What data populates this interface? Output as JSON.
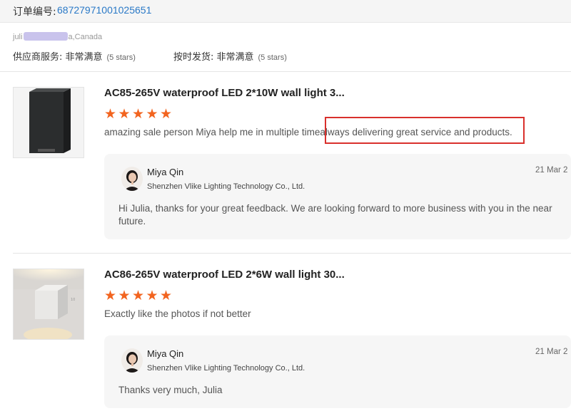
{
  "order": {
    "label": "订单编号:",
    "number": "68727971001025651"
  },
  "buyer": {
    "name_prefix": "juli",
    "location": "a,Canada"
  },
  "ratings": {
    "supplier_service_label": "供应商服务: 非常满意",
    "supplier_service_stars": "(5 stars)",
    "on_time_label": "按时发货: 非常满意",
    "on_time_stars": "(5 stars)"
  },
  "reviews": [
    {
      "product_title": "AC85-265V waterproof LED 2*10W wall light 3...",
      "rating": 5,
      "text_part1": "amazing sale person Miya help me in multiple time",
      "text_part2": "always delivering great service and products.",
      "reply": {
        "name": "Miya Qin",
        "company": "Shenzhen Vlike Lighting Technology Co., Ltd.",
        "date": "21 Mar 2",
        "text": "Hi Julia, thanks for your great feedback. We are looking forward to more business with you in the near future."
      }
    },
    {
      "product_title": "AC86-265V waterproof LED 2*6W wall light 30...",
      "rating": 5,
      "text": "Exactly like the photos if not better",
      "reply": {
        "name": "Miya Qin",
        "company": "Shenzhen Vlike Lighting Technology Co., Ltd.",
        "date": "21 Mar 2",
        "text": "Thanks very much, Julia"
      }
    }
  ],
  "colors": {
    "star": "#f2641f",
    "link": "#2a79c7",
    "highlight_border": "#d9302c"
  }
}
